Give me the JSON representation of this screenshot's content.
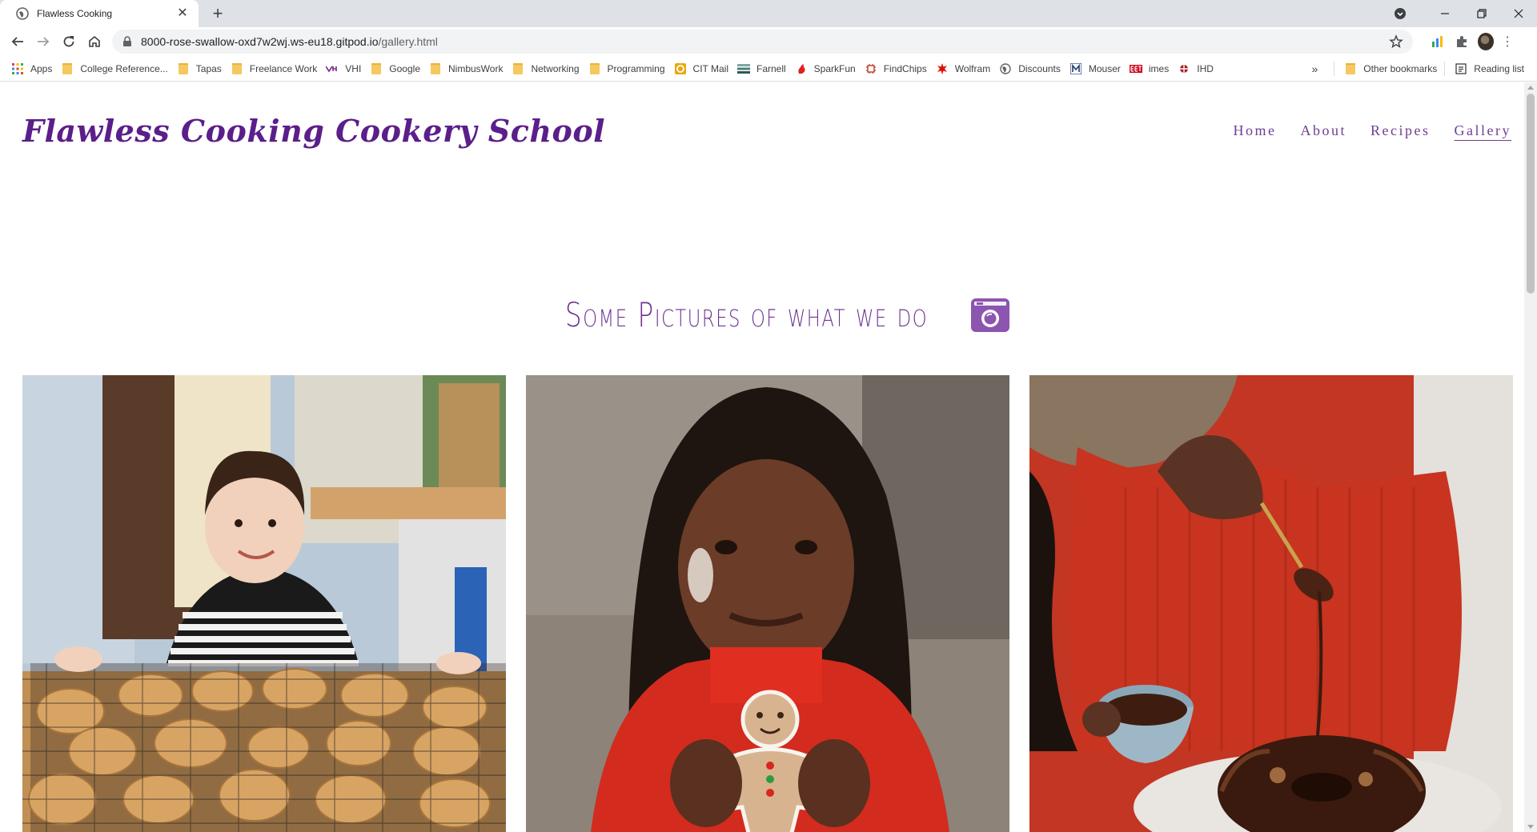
{
  "browser": {
    "tab_title": "Flawless Cooking",
    "url_host": "8000-rose-swallow-oxd7w2wj.ws-eu18.gitpod.io",
    "url_path": "/gallery.html",
    "bookmarks": [
      {
        "label": "Apps",
        "icon": "apps-grid-icon"
      },
      {
        "label": "College Reference...",
        "icon": "folder-icon"
      },
      {
        "label": "Tapas",
        "icon": "folder-icon"
      },
      {
        "label": "Freelance Work",
        "icon": "folder-icon"
      },
      {
        "label": "VHI",
        "icon": "vhi-icon"
      },
      {
        "label": "Google",
        "icon": "folder-icon"
      },
      {
        "label": "NimbusWork",
        "icon": "folder-icon"
      },
      {
        "label": "Networking",
        "icon": "folder-icon"
      },
      {
        "label": "Programming",
        "icon": "folder-icon"
      },
      {
        "label": "CIT Mail",
        "icon": "mail-icon"
      },
      {
        "label": "Farnell",
        "icon": "farnell-icon"
      },
      {
        "label": "SparkFun",
        "icon": "sparkfun-icon"
      },
      {
        "label": "FindChips",
        "icon": "findchips-icon"
      },
      {
        "label": "Wolfram",
        "icon": "wolfram-icon"
      },
      {
        "label": "Discounts",
        "icon": "globe-icon"
      },
      {
        "label": "Mouser",
        "icon": "mouser-icon"
      },
      {
        "label": "imes",
        "icon": "eet-icon"
      },
      {
        "label": "IHD",
        "icon": "ihd-icon"
      }
    ],
    "more_label": "»",
    "other_bookmarks": "Other bookmarks",
    "reading_list": "Reading list"
  },
  "site": {
    "brand": "Flawless Cooking Cookery School",
    "nav": [
      {
        "label": "Home"
      },
      {
        "label": "About"
      },
      {
        "label": "Recipes"
      },
      {
        "label": "Gallery"
      }
    ],
    "heading": "Some Pictures of what we do"
  },
  "colors": {
    "brand": "#5b1e8a",
    "nav": "#6f3d93",
    "heading": "#6d3391",
    "camera_icon": "#8b55b0"
  }
}
